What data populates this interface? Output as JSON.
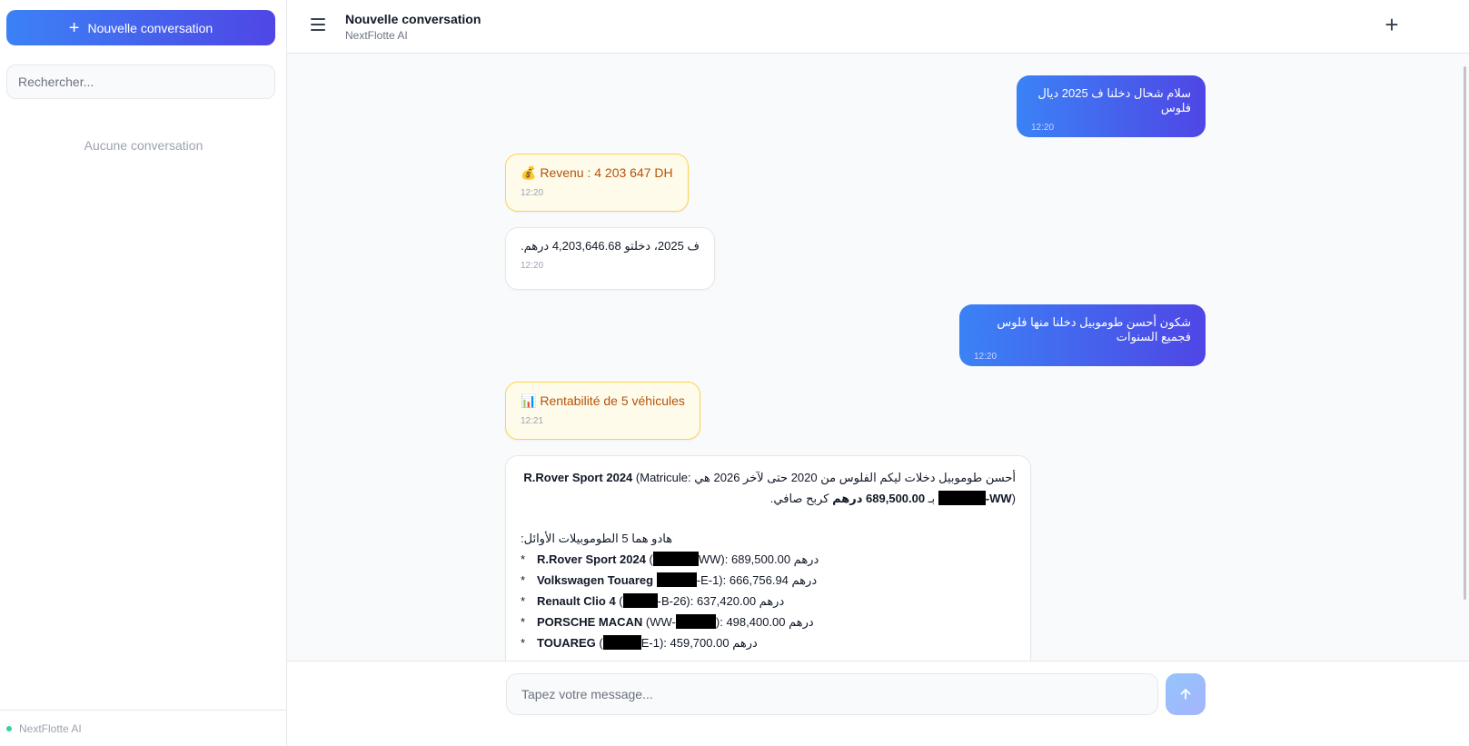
{
  "sidebar": {
    "new_conversation_label": "Nouvelle conversation",
    "search_placeholder": "Rechercher...",
    "empty_text": "Aucune conversation",
    "footer_label": "NextFlotte AI"
  },
  "header": {
    "title": "Nouvelle conversation",
    "subtitle": "NextFlotte AI"
  },
  "messages": [
    {
      "role": "user",
      "text": "سلام شحال دخلنا ف 2025 ديال فلوس",
      "time": "12:20"
    },
    {
      "role": "status",
      "icon": "money-bag-icon",
      "emoji": "💰",
      "text": "Revenu : 4 203 647 DH",
      "time": "12:20"
    },
    {
      "role": "assistant",
      "text": "ف 2025، دخلتو 4,203,646.68 درهم.",
      "time": "12:20"
    },
    {
      "role": "user",
      "text": "شكون أحسن طوموبيل دخلنا منها فلوس فجميع السنوات",
      "time": "12:20"
    },
    {
      "role": "status",
      "icon": "bar-chart-icon",
      "emoji": "📊",
      "text": "Rentabilité de 5 véhicules",
      "time": "12:21"
    },
    {
      "role": "assistant",
      "intro_a": "أحسن طوموبيل دخلات ليكم الفلوس من 2020 حتى لآخر 2026 هي ",
      "intro_vehicle": "R.Rover Sport 2024",
      "intro_b": " (Matricule:",
      "intro_plate_suffix": "-WW",
      "intro_c": ") بـ ",
      "intro_amount": "689,500.00 درهم",
      "intro_d": " كربح صافي.",
      "list_title": "هادو هما 5 الطوموبيلات الأوائل:",
      "items": [
        {
          "name": "R.Rover Sport 2024",
          "plate_prefix": " (",
          "plate_suffix": "WW)",
          "value": ": 689,500.00 درهم"
        },
        {
          "name": "Volkswagen Touareg",
          "plate_prefix": " ",
          "plate_suffix": "-E-1)",
          "value": ": 666,756.94 درهم"
        },
        {
          "name": "Renault Clio 4",
          "plate_prefix": " (",
          "plate_suffix": "-B-26)",
          "value": ": 637,420.00 درهم"
        },
        {
          "name": "PORSCHE MACAN",
          "plate_prefix": " (WW-",
          "plate_suffix": ")",
          "value": ": 498,400.00 درهم"
        },
        {
          "name": "TOUAREG",
          "plate_prefix": " (",
          "plate_suffix": "E-1)",
          "value": ": 459,700.00 درهم"
        }
      ],
      "bullet": "*"
    }
  ],
  "composer": {
    "placeholder": "Tapez votre message..."
  }
}
